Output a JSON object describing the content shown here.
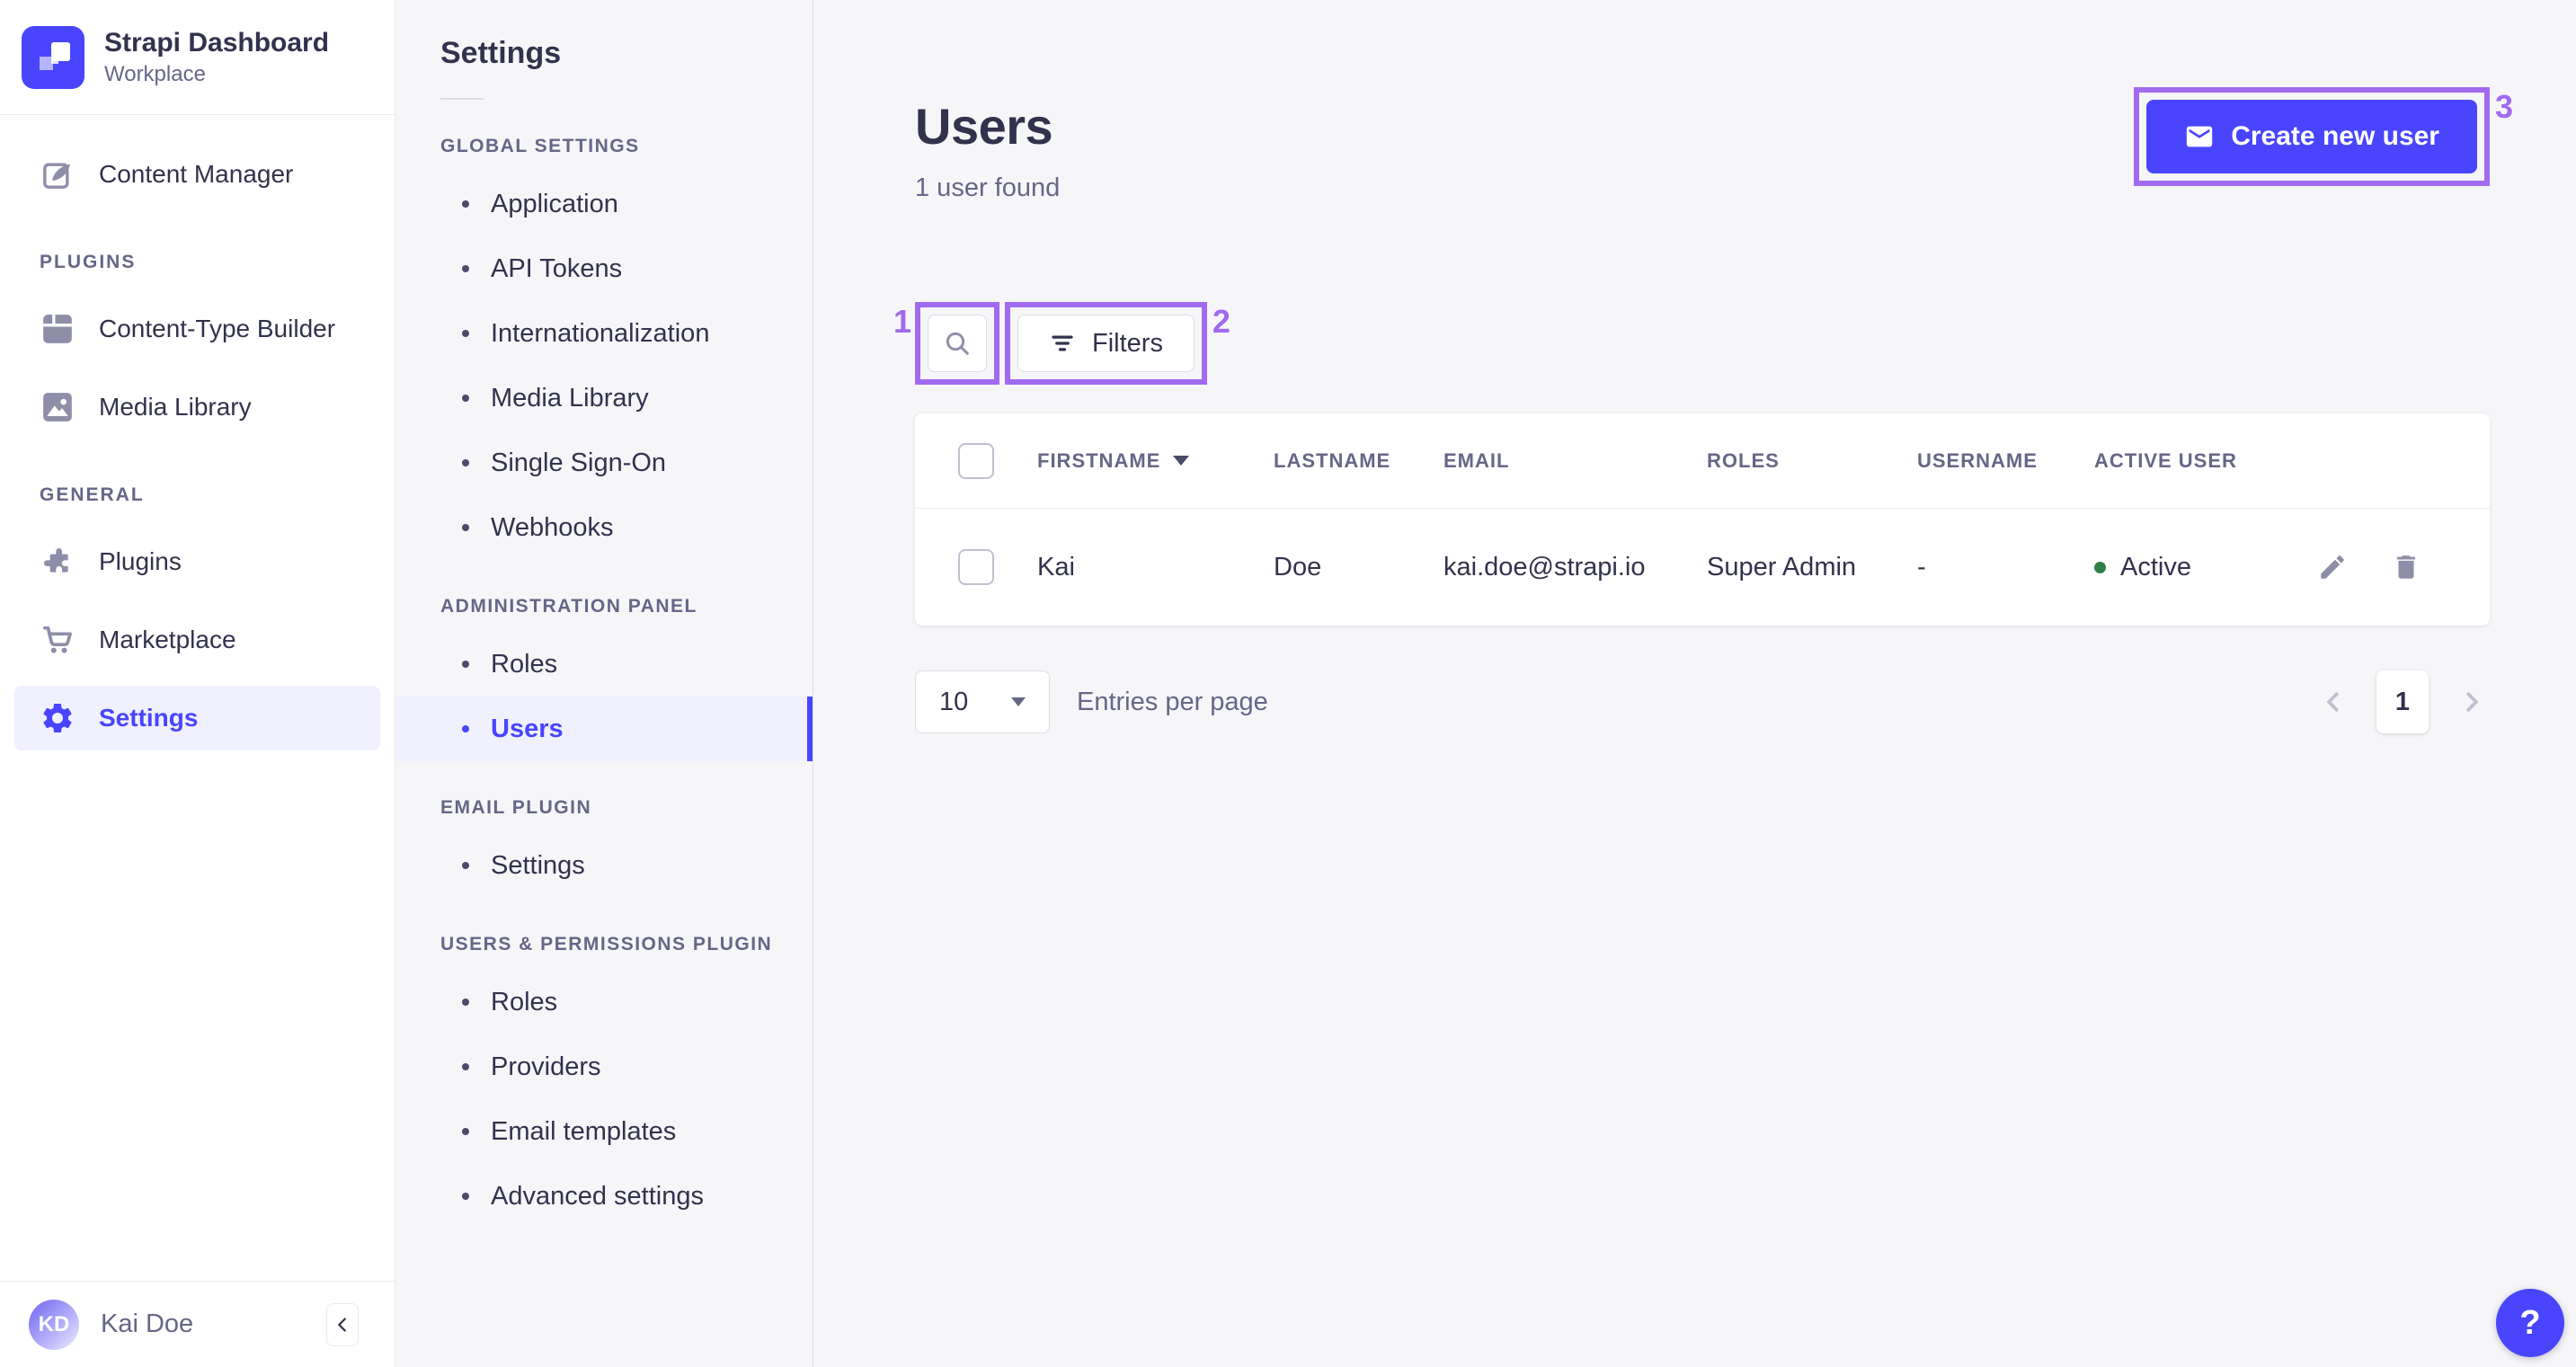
{
  "app": {
    "name": "Strapi Dashboard",
    "workspace": "Workplace"
  },
  "colors": {
    "accent": "#4945FF",
    "accent_light_bg": "#F0F0FF",
    "annotation": "#A16AEF",
    "success_dot": "#328048"
  },
  "sidebar": {
    "content_manager": "Content Manager",
    "sections": [
      {
        "title": "PLUGINS",
        "items": [
          {
            "label": "Content-Type Builder"
          },
          {
            "label": "Media Library"
          }
        ]
      },
      {
        "title": "GENERAL",
        "items": [
          {
            "label": "Plugins"
          },
          {
            "label": "Marketplace"
          },
          {
            "label": "Settings"
          }
        ]
      }
    ],
    "user": {
      "initials": "KD",
      "name": "Kai Doe"
    }
  },
  "subnav": {
    "title": "Settings",
    "sections": [
      {
        "title": "GLOBAL SETTINGS",
        "items": [
          "Application",
          "API Tokens",
          "Internationalization",
          "Media Library",
          "Single Sign-On",
          "Webhooks"
        ]
      },
      {
        "title": "ADMINISTRATION PANEL",
        "items": [
          "Roles",
          "Users"
        ]
      },
      {
        "title": "EMAIL PLUGIN",
        "items": [
          "Settings"
        ]
      },
      {
        "title": "USERS & PERMISSIONS PLUGIN",
        "items": [
          "Roles",
          "Providers",
          "Email templates",
          "Advanced settings"
        ]
      }
    ]
  },
  "main": {
    "title": "Users",
    "subtitle": "1 user found",
    "create_button": "Create new user",
    "filters_button": "Filters",
    "table": {
      "columns": [
        "FIRSTNAME",
        "LASTNAME",
        "EMAIL",
        "ROLES",
        "USERNAME",
        "ACTIVE USER"
      ],
      "rows": [
        {
          "firstname": "Kai",
          "lastname": "Doe",
          "email": "kai.doe@strapi.io",
          "roles": "Super Admin",
          "username": "-",
          "active_status": "Active"
        }
      ]
    },
    "pagination": {
      "page_size": "10",
      "entries_label": "Entries per page",
      "current_page": "1"
    }
  },
  "annotations": {
    "search": "1",
    "filters": "2",
    "create": "3"
  },
  "help_label": "?"
}
